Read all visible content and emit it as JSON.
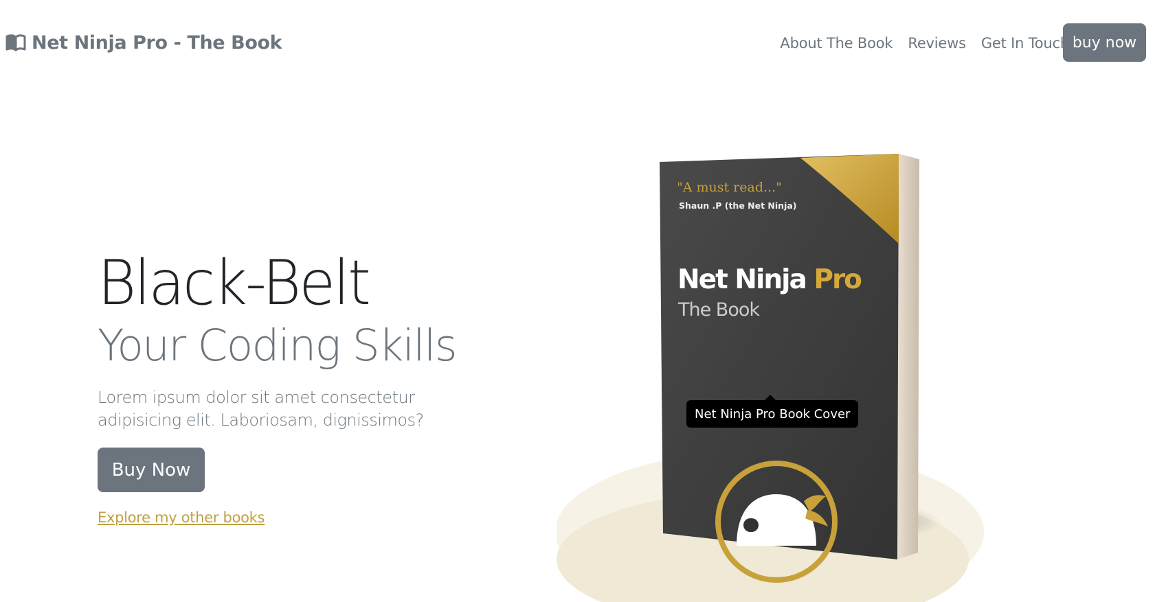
{
  "brand": {
    "icon": "book-icon",
    "title": "Net Ninja Pro - The Book"
  },
  "nav": {
    "links": [
      "About The Book",
      "Reviews",
      "Get In Touch"
    ],
    "cta": "buy now"
  },
  "hero": {
    "title": "Black-Belt",
    "subtitle": "Your Coding Skills",
    "lead": "Lorem ipsum dolor sit amet consectetur adipisicing elit. Laboriosam, dignissimos?",
    "button": "Buy Now",
    "link": "Explore my other books"
  },
  "book": {
    "quote": "\"A must read...\"",
    "quote_author": "Shaun .P (the Net Ninja)",
    "title_main": "Net Ninja",
    "title_accent": "Pro",
    "subtitle": "The Book",
    "tooltip": "Net Ninja Pro Book Cover"
  },
  "colors": {
    "secondary": "#6c757d",
    "gold": "#c9a13b",
    "cover": "#3c3c3c",
    "link": "#c0a040"
  }
}
